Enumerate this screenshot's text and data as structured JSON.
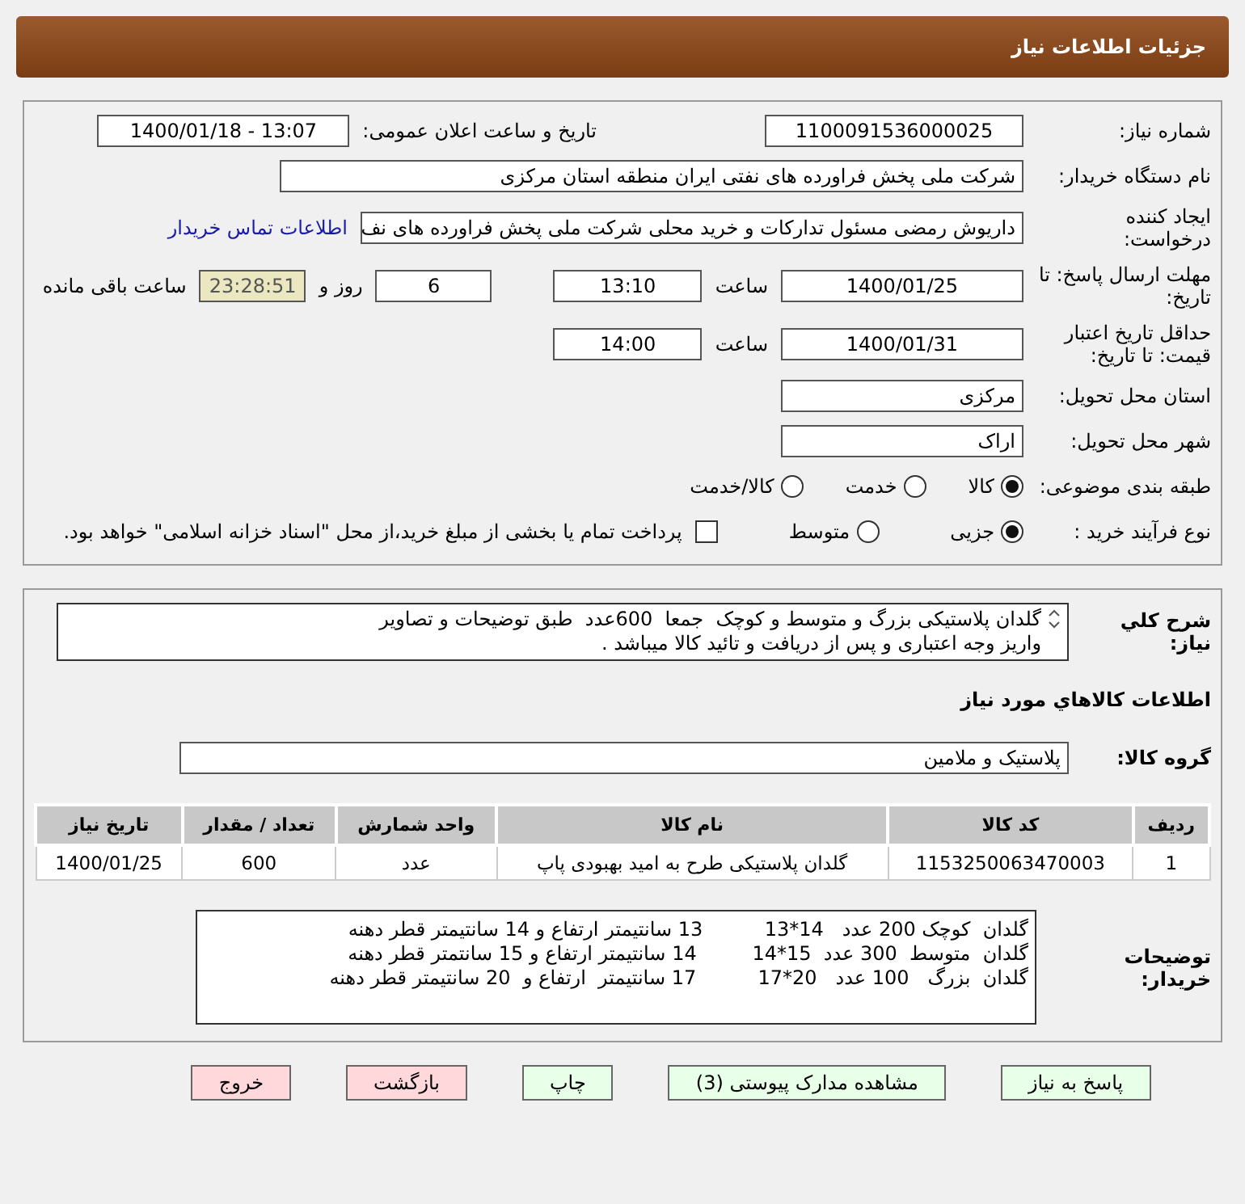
{
  "window": {
    "title": "جزئیات اطلاعات نیاز"
  },
  "need": {
    "number_label": "شماره نیاز:",
    "number": "1100091536000025",
    "announce_label": "تاریخ و ساعت اعلان عمومی:",
    "announce": "1400/01/18 - 13:07",
    "buyer_label": "نام دستگاه خریدار:",
    "buyer": "شرکت ملی پخش فراورده های نفتی ایران منطقه استان مرکزی",
    "requester_label": "ایجاد کننده درخواست:",
    "requester": "داریوش رمضی مسئول تدارکات و خرید محلی شرکت ملی پخش فراورده های نف",
    "contact_link": "اطلاعات تماس خریدار",
    "deadline_label": "مهلت ارسال پاسخ: تا تاریخ:",
    "deadline_date": "1400/01/25",
    "time_label": "ساعت",
    "deadline_time": "13:10",
    "days": "6",
    "days_label": "روز و",
    "remaining": "23:28:51",
    "remaining_label": "ساعت باقی مانده",
    "validity_label": "حداقل تاریخ اعتبار قیمت: تا تاریخ:",
    "validity_date": "1400/01/31",
    "validity_time_label": "ساعت",
    "validity_time": "14:00",
    "province_label": "استان محل تحویل:",
    "province": "مرکزی",
    "city_label": "شهر محل تحویل:",
    "city": "اراک",
    "category_label": "طبقه بندی موضوعی:",
    "categories": [
      {
        "label": "کالا",
        "selected": true
      },
      {
        "label": "خدمت",
        "selected": false
      },
      {
        "label": "کالا/خدمت",
        "selected": false
      }
    ],
    "process_label": "نوع فرآیند خرید :",
    "processes": [
      {
        "label": "جزیی",
        "selected": true
      },
      {
        "label": "متوسط",
        "selected": false
      }
    ],
    "treasury": {
      "label": "پرداخت تمام یا بخشی از مبلغ خرید،از محل \"اسناد خزانه اسلامی\" خواهد بود.",
      "checked": false
    }
  },
  "summary": {
    "label": "شرح کلي نياز:",
    "lines": [
      "گلدان پلاستیکی بزرگ و متوسط و کوچک  جمعا  600عدد  طبق توضیحات و تصاویر",
      "واریز وجه اعتباری و پس از دریافت و تائید کالا میباشد ."
    ]
  },
  "goods": {
    "title": "اطلاعات کالاهاي مورد نياز",
    "group_label": "گروه کالا:",
    "group": "پلاستیک و ملامین",
    "table": {
      "columns": [
        "ردیف",
        "کد کالا",
        "نام کالا",
        "واحد شمارش",
        "تعداد / مقدار",
        "تاریخ نیاز"
      ],
      "rows": [
        [
          "1",
          "1153250063470003",
          "گلدان پلاستیکی طرح به امید بهبودی پاپ",
          "عدد",
          "600",
          "1400/01/25"
        ]
      ]
    },
    "notes_label": "توضیحات خریدار:",
    "notes": [
      "گلدان  کوچک 200 عدد   14*13          13 سانتیمتر ارتفاع و 14 سانتیمتر قطر دهنه",
      "گلدان  متوسط  300 عدد  15*14         14 سانتیمتر ارتفاع و 15 سانتمتر قطر دهنه",
      "گلدان  بزرگ   100 عدد   20*17          17 سانتیمتر  ارتفاع و  20 سانتیمتر قطر دهنه"
    ]
  },
  "buttons": [
    {
      "label": "پاسخ به نیاز",
      "color": "#e8ffe8"
    },
    {
      "label": "مشاهده مدارک پیوستی (3)",
      "color": "#e8ffe8"
    },
    {
      "label": "چاپ",
      "color": "#e8ffe8"
    },
    {
      "label": "بازگشت",
      "color": "#ffd8dc"
    },
    {
      "label": "خروج",
      "color": "#ffd8dc"
    }
  ]
}
